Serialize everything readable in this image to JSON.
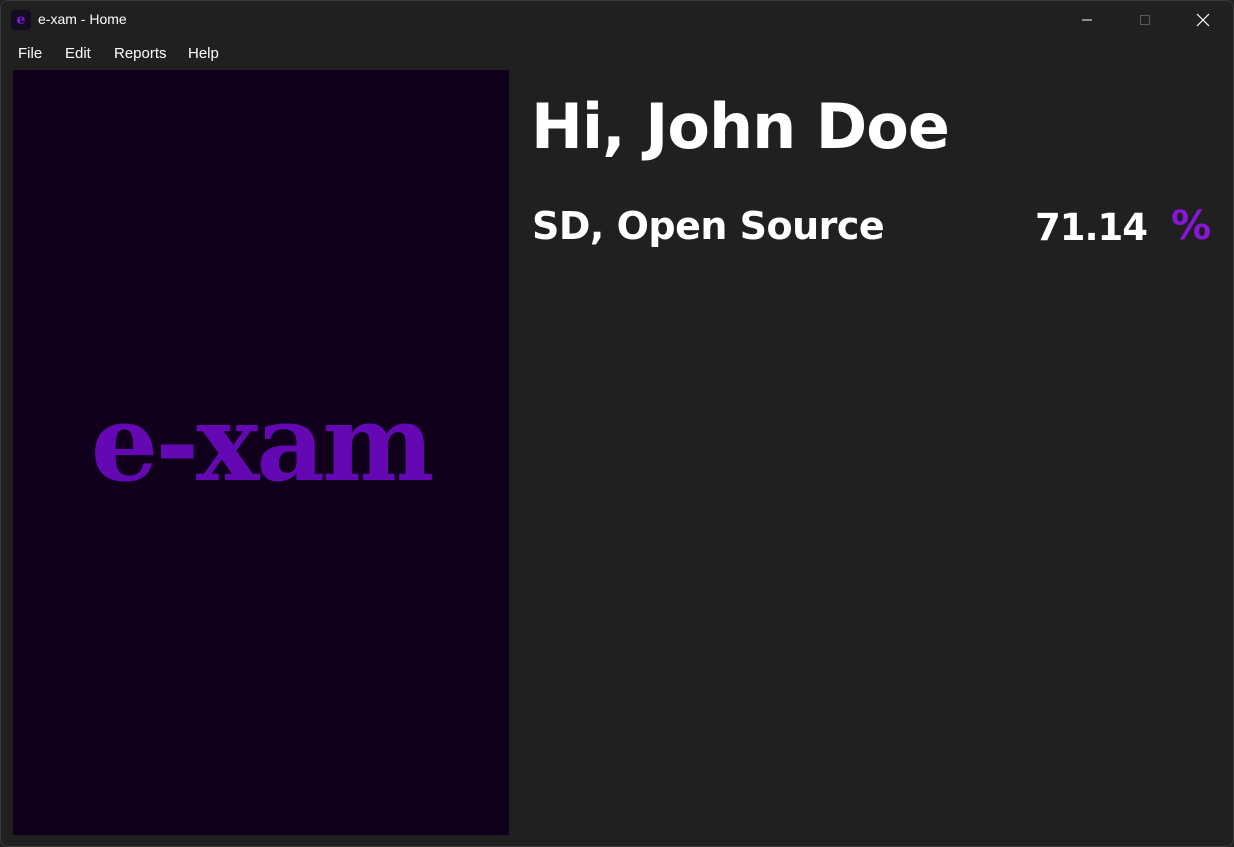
{
  "window": {
    "title": "e-xam - Home",
    "app_icon_glyph": "e"
  },
  "menu": {
    "items": [
      "File",
      "Edit",
      "Reports",
      "Help"
    ]
  },
  "logo": {
    "text": "e-xam"
  },
  "main": {
    "greeting": "Hi, John Doe",
    "courses": [
      {
        "name": "SD, Open Source",
        "score": "71.14",
        "unit": "%"
      }
    ]
  },
  "colors": {
    "accent": "#6408b4",
    "percent": "#8a16d8",
    "window_bg": "#202020",
    "logo_panel_bg": "#10001b"
  },
  "icons": {
    "minimize": "minimize-icon",
    "maximize": "maximize-icon",
    "close": "close-icon"
  }
}
